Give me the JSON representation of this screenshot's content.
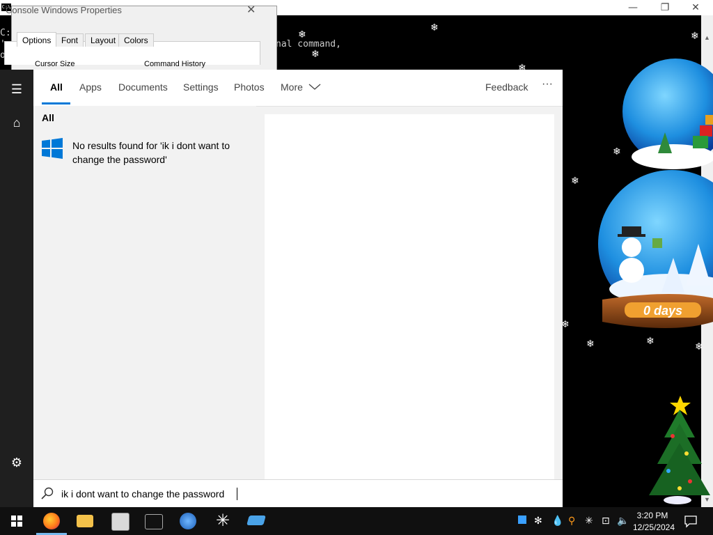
{
  "console": {
    "line1": "C:",
    "line2": "'g",
    "line3": "op",
    "partial_text": "nal command,"
  },
  "properties_dialog": {
    "title": "Console Windows Properties",
    "tabs": [
      "Options",
      "Font",
      "Layout",
      "Colors"
    ],
    "cursor_size_label": "Cursor Size",
    "command_history_label": "Command History"
  },
  "search": {
    "tabs": {
      "all": "All",
      "apps": "Apps",
      "documents": "Documents",
      "settings": "Settings",
      "photos": "Photos",
      "more": "More"
    },
    "feedback": "Feedback",
    "overflow": "···",
    "results_heading": "All",
    "no_results_text": "No results found for 'ik i dont want to change the password'",
    "query": "ik i dont want to change the password"
  },
  "snow_globe": {
    "counter": "0 days"
  },
  "taskbar": {
    "clock_time": "3:20 PM",
    "clock_date": "12/25/2024"
  },
  "colors": {
    "accent": "#0078d7",
    "rail": "#1f1f1f",
    "taskbar": "#101010"
  }
}
